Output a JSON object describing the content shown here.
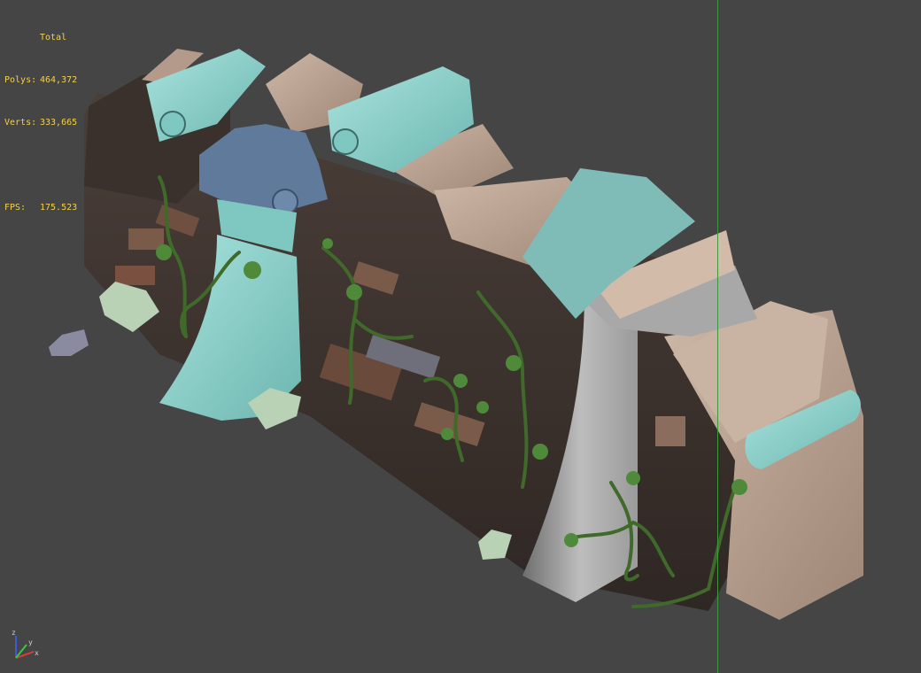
{
  "stats": {
    "title": "Total",
    "polys_label": "Polys:",
    "polys_value": "464,372",
    "verts_label": "Verts:",
    "verts_value": "333,665",
    "fps_label": "FPS:",
    "fps_value": "175.523"
  },
  "axis_gizmo": {
    "z_label": "z",
    "y_label": "y",
    "x_label": "x"
  },
  "colors": {
    "background": "#454545",
    "stats_text": "#f2d24a",
    "grid_line": "#3f9a3f",
    "stone": "#b49c8c",
    "teal": "#8fd1cc",
    "wall": "#3e3531",
    "vine": "#3f6a2a"
  }
}
